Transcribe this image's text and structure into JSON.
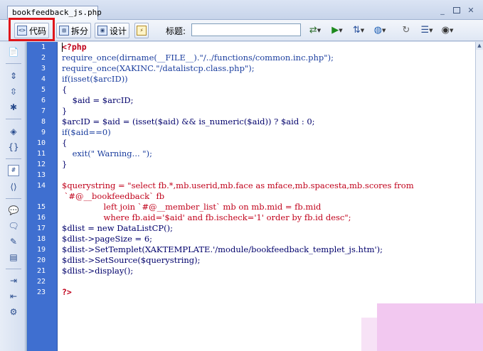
{
  "tab": {
    "filename": "bookfeedback_js.php"
  },
  "window_controls": {
    "minimize": "_",
    "restore": "▭",
    "close": "✕"
  },
  "toolbar": {
    "code_label": "代码",
    "split_label": "拆分",
    "design_label": "设计",
    "title_label": "标题:",
    "title_value": ""
  },
  "highlight_color": "#e0161b",
  "gutter_color": "#3f6fd0",
  "code": {
    "line_numbers": [
      "1",
      "2",
      "3",
      "4",
      "5",
      "6",
      "7",
      "8",
      "9",
      "10",
      "11",
      "12",
      "13",
      "14",
      "15",
      "16",
      "17",
      "18",
      "19",
      "20",
      "21",
      "22",
      "23"
    ],
    "lines": [
      "<?php",
      "require_once(dirname(__FILE__).\"/../functions/common.inc.php\");",
      "require_once(XAKINC.\"/datalistcp.class.php\");",
      "if(isset($arcID))",
      "{",
      "    $aid = $arcID;",
      "}",
      "$arcID = $aid = (isset($aid) && is_numeric($aid)) ? $aid : 0;",
      "if($aid==0)",
      "{",
      "    exit(\" Warning... \");",
      "}",
      "",
      "$querystring = \"select fb.*,mb.userid,mb.face as mface,mb.spacesta,mb.scores from",
      "                left join `#@__member_list` mb on mb.mid = fb.mid",
      "                where fb.aid='$aid' and fb.ischeck='1' order by fb.id desc\";",
      "$dlist = new DataListCP();",
      "$dlist->pageSize = 6;",
      "$dlist->SetTemplet(XAKTEMPLATE.'/module/bookfeedback_templet_js.htm');",
      "$dlist->SetSource($querystring);",
      "$dlist->display();",
      "",
      "?>"
    ],
    "wrap_continuation": " `#@__bookfeedback` fb"
  }
}
